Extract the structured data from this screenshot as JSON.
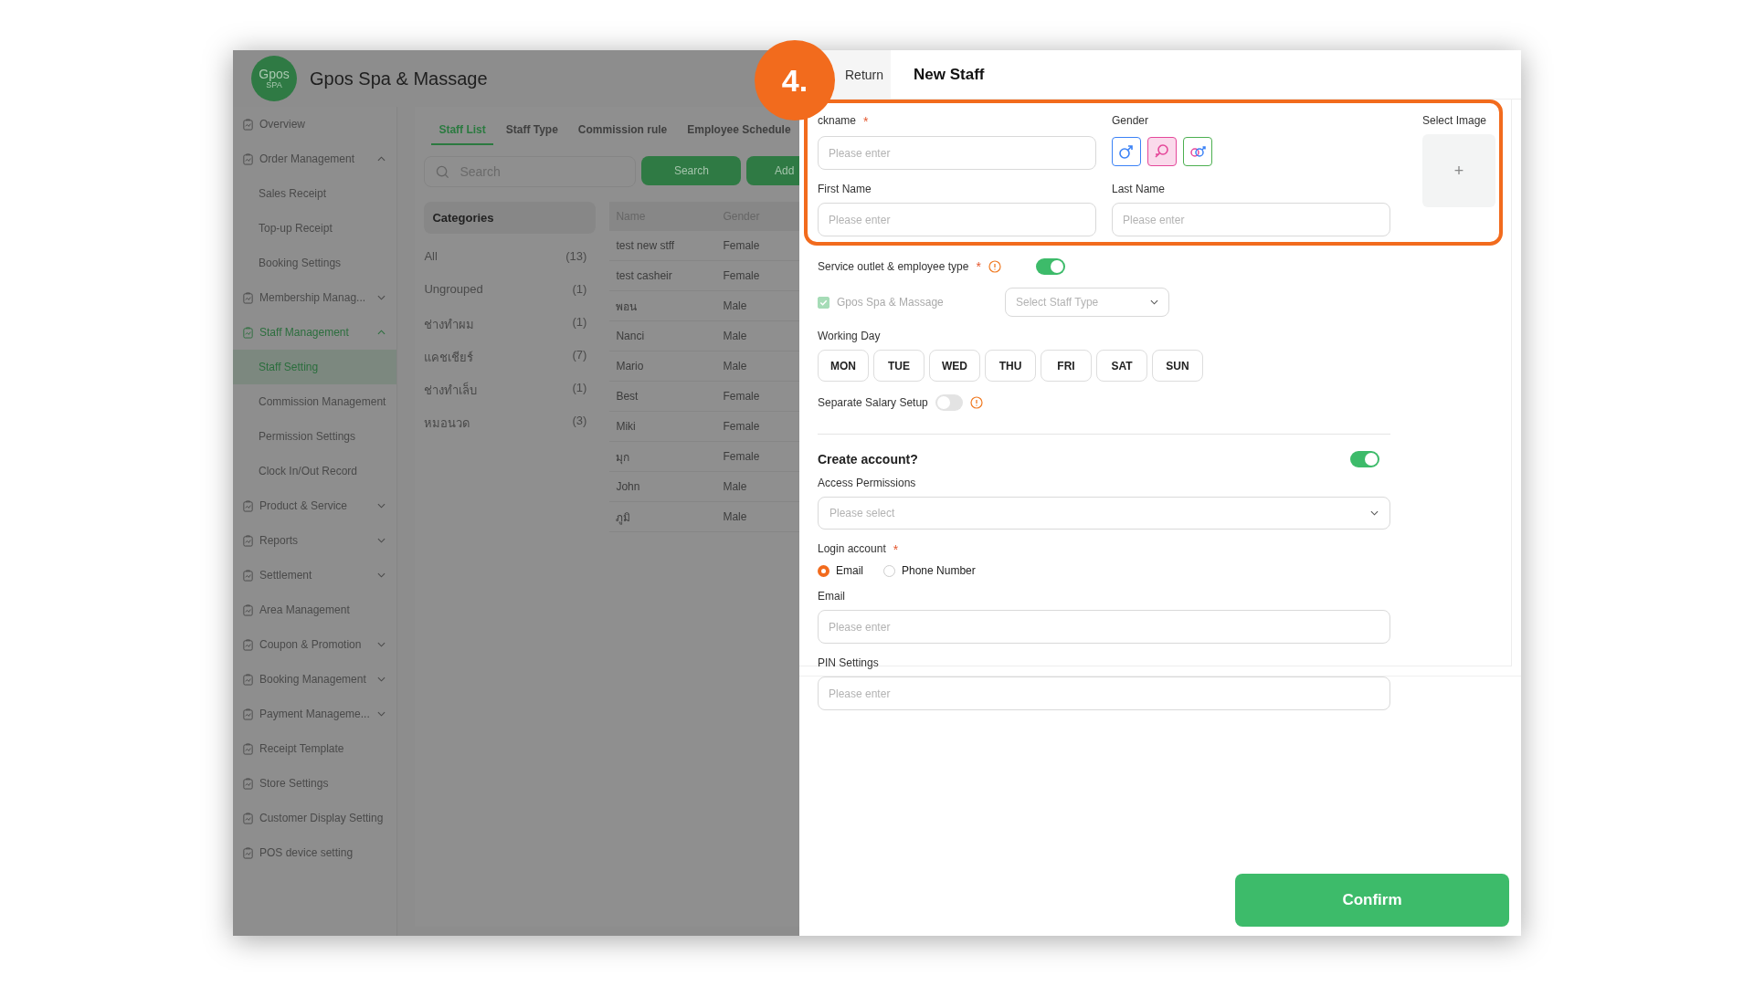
{
  "app": {
    "title": "Gpos Spa & Massage",
    "logo_text": "Gpos",
    "logo_sub": "SPA"
  },
  "sidebar": {
    "items": [
      {
        "label": "Overview",
        "selected": false
      },
      {
        "label": "Order Management",
        "selected": false,
        "expanded": true,
        "children": [
          {
            "label": "Sales Receipt",
            "selected": false
          },
          {
            "label": "Top-up Receipt",
            "selected": false
          },
          {
            "label": "Booking Settings",
            "selected": false
          }
        ]
      },
      {
        "label": "Membership Manag...",
        "selected": false,
        "expanded": false
      },
      {
        "label": "Staff Management",
        "selected": false,
        "expanded": true,
        "children": [
          {
            "label": "Staff Setting",
            "selected": true
          },
          {
            "label": "Commission Management",
            "selected": false
          },
          {
            "label": "Permission Settings",
            "selected": false
          },
          {
            "label": "Clock In/Out Record",
            "selected": false
          }
        ]
      },
      {
        "label": "Product & Service",
        "selected": false,
        "expanded": false
      },
      {
        "label": "Reports",
        "selected": false,
        "expanded": false
      },
      {
        "label": "Settlement",
        "selected": false,
        "expanded": false
      },
      {
        "label": "Area Management",
        "selected": false
      },
      {
        "label": "Coupon & Promotion",
        "selected": false,
        "expanded": false
      },
      {
        "label": "Booking Management",
        "selected": false,
        "expanded": false
      },
      {
        "label": "Payment Manageme...",
        "selected": false,
        "expanded": false
      },
      {
        "label": "Receipt Template",
        "selected": false
      },
      {
        "label": "Store Settings",
        "selected": false
      },
      {
        "label": "Customer Display Setting",
        "selected": false
      },
      {
        "label": "POS device setting",
        "selected": false
      }
    ]
  },
  "tabs": [
    {
      "label": "Staff List",
      "selected": true
    },
    {
      "label": "Staff Type",
      "selected": false
    },
    {
      "label": "Commission rule",
      "selected": false
    },
    {
      "label": "Employee Schedule",
      "selected": false
    }
  ],
  "search": {
    "placeholder": "Search",
    "button": "Search",
    "add_button": "Add"
  },
  "categories": {
    "title": "Categories",
    "items": [
      {
        "name": "All",
        "count": "(13)",
        "selected": false
      },
      {
        "name": "Ungrouped",
        "count": "(1)",
        "selected": false
      },
      {
        "name": "ช่างทำผม",
        "count": "(1)",
        "selected": false
      },
      {
        "name": "แคชเชียร์",
        "count": "(7)",
        "selected": false
      },
      {
        "name": "ช่างทำเล็บ",
        "count": "(1)",
        "selected": false
      },
      {
        "name": "หมอนวด",
        "count": "(3)",
        "selected": false
      }
    ]
  },
  "table": {
    "columns": [
      "Name",
      "Gender"
    ],
    "rows": [
      [
        "test new stff",
        "Female"
      ],
      [
        "test casheir",
        "Female"
      ],
      [
        "พอน",
        "Male"
      ],
      [
        "Nanci",
        "Male"
      ],
      [
        "Mario",
        "Male"
      ],
      [
        "Best",
        "Female"
      ],
      [
        "Miki",
        "Female"
      ],
      [
        "มุก",
        "Female"
      ],
      [
        "John",
        "Male"
      ],
      [
        "ภูมิ",
        "Male"
      ]
    ]
  },
  "drawer": {
    "return": "Return",
    "title": "New Staff",
    "nickname": {
      "label": "ckname",
      "required_mark": "*",
      "placeholder": "Please enter"
    },
    "gender": {
      "label": "Gender",
      "options": [
        {
          "kind": "male",
          "selected": false,
          "color": "#3b82f6"
        },
        {
          "kind": "female",
          "selected": true,
          "color": "#e5489a"
        },
        {
          "kind": "both",
          "selected": false,
          "color": "#4caf50"
        }
      ]
    },
    "select_image": {
      "label": "Select Image",
      "symbol": "+"
    },
    "first_name": {
      "label": "First Name",
      "placeholder": "Please enter"
    },
    "last_name": {
      "label": "Last Name",
      "placeholder": "Please enter"
    },
    "service_outlet": {
      "label": "Service outlet & employee type",
      "required_mark": "*",
      "on": true,
      "outlet": "Gpos Spa & Massage",
      "checked": true,
      "staff_type_placeholder": "Select Staff Type"
    },
    "working_day": {
      "label": "Working Day",
      "days": [
        {
          "label": "MON",
          "selected": false
        },
        {
          "label": "TUE",
          "selected": false
        },
        {
          "label": "WED",
          "selected": false
        },
        {
          "label": "THU",
          "selected": false
        },
        {
          "label": "FRI",
          "selected": false
        },
        {
          "label": "SAT",
          "selected": false
        },
        {
          "label": "SUN",
          "selected": false
        }
      ]
    },
    "separate_salary": {
      "label": "Separate Salary Setup",
      "on": false
    },
    "create_account": {
      "label": "Create account?",
      "on": true
    },
    "access_permissions": {
      "label": "Access Permissions",
      "placeholder": "Please select"
    },
    "login_account": {
      "label": "Login account",
      "required_mark": "*",
      "options": [
        {
          "label": "Email",
          "selected": true
        },
        {
          "label": "Phone Number",
          "selected": false
        }
      ]
    },
    "email": {
      "label": "Email",
      "placeholder": "Please enter"
    },
    "pin": {
      "label": "PIN Settings",
      "placeholder": "Please enter"
    },
    "confirm": "Confirm"
  },
  "callout": {
    "step": "4."
  }
}
